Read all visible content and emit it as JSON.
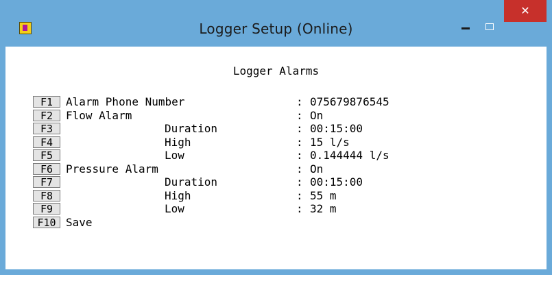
{
  "window": {
    "title": "Logger Setup (Online)",
    "icon": "app-icon",
    "controls": {
      "minimize": "minimize-icon",
      "maximize": "maximize-icon",
      "close_glyph": "✕"
    }
  },
  "content": {
    "heading": "Logger Alarms",
    "separator": ":",
    "rows": [
      {
        "key": "F1",
        "label": "Alarm Phone Number",
        "value": "075679876545"
      },
      {
        "key": "F2",
        "label": "Flow Alarm",
        "value": "On"
      },
      {
        "key": "F3",
        "label": "Duration",
        "value": "00:15:00"
      },
      {
        "key": "F4",
        "label": "High",
        "value": "15 l/s"
      },
      {
        "key": "F5",
        "label": "Low",
        "value": "0.144444 l/s"
      },
      {
        "key": "F6",
        "label": "Pressure Alarm",
        "value": "On"
      },
      {
        "key": "F7",
        "label": "Duration",
        "value": "00:15:00"
      },
      {
        "key": "F8",
        "label": "High",
        "value": "55 m"
      },
      {
        "key": "F9",
        "label": "Low",
        "value": "32 m"
      },
      {
        "key": "F10",
        "label": "Save",
        "value": ""
      }
    ]
  },
  "colors": {
    "titlebar": "#6aaad9",
    "close": "#c7302b",
    "background": "#ffffff"
  }
}
